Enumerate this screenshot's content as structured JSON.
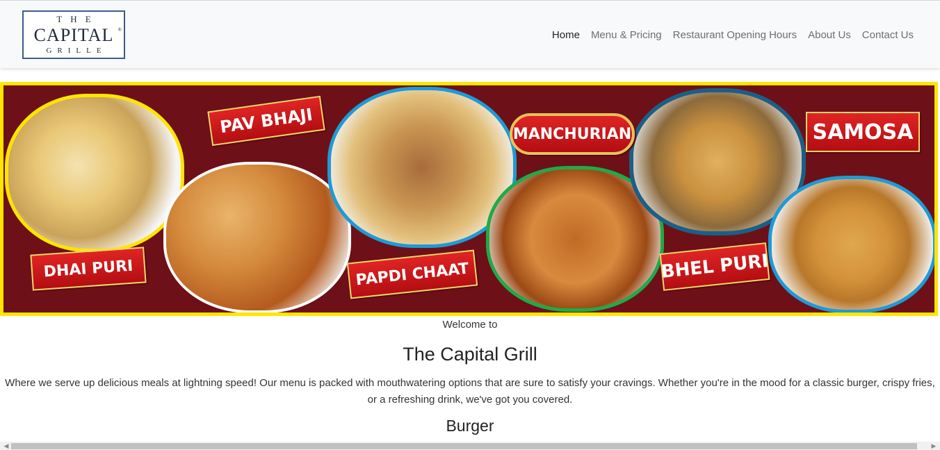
{
  "brand": {
    "line1": "THE",
    "line2": "CAPITAL",
    "line3": "GRILLE",
    "registered": "®"
  },
  "nav": {
    "items": [
      "Home",
      "Menu & Pricing",
      "Restaurant Opening Hours",
      "About Us",
      "Contact Us"
    ]
  },
  "banner": {
    "labels": {
      "pav_bhaji": "PAV BHAJI",
      "manchurian": "MANCHURIAN",
      "samosa": "SAMOSA",
      "dhai_puri": "DHAI PURI",
      "papdi_chaat": "PAPDI CHAAT",
      "bhel_puri": "BHEL PURI"
    }
  },
  "main": {
    "welcome": "Welcome to",
    "title": "The Capital Grill",
    "description": "Where we serve up delicious meals at lightning speed! Our menu is packed with mouthwatering options that are sure to satisfy your cravings. Whether you're in the mood for a classic burger, crispy fries, or a refreshing drink, we've got you covered.",
    "section_heading": "Burger"
  },
  "colors": {
    "banner_bg": "#6e1017",
    "banner_border": "#ffe500",
    "ribbon": "#d21a1f"
  }
}
